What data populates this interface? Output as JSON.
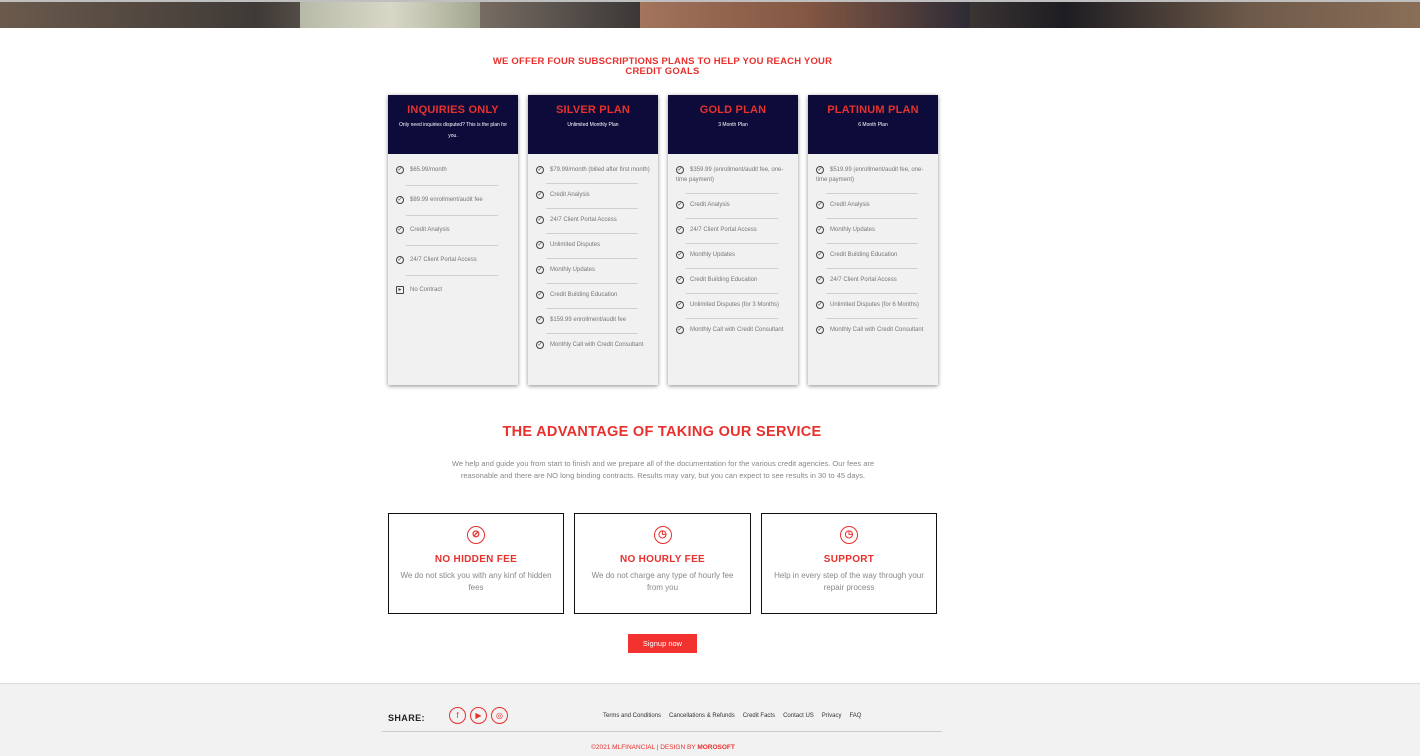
{
  "offer_title": "WE OFFER FOUR SUBSCRIPTIONS PLANS TO HELP YOU REACH YOUR CREDIT GOALS",
  "plans": [
    {
      "name": "INQUIRIES ONLY",
      "subtitle": "Only need inquiries disputed? This is the plan for you.",
      "features": [
        "$65.99/month",
        "$89.99 enrollment/audit fee",
        "Credit Analysis",
        "24/7 Client Portal Access",
        "No Contract"
      ]
    },
    {
      "name": "SILVER PLAN",
      "subtitle": "Unlimited Monthly Plan",
      "features": [
        "$79.99/month (billed after first month)",
        "Credit Analysis",
        "24/7 Client Portal Access",
        "Unlimited Disputes",
        "Monthly Updates",
        "Credit Building Education",
        "$159.99 enrollment/audit fee",
        "Monthly Call with Credit Consultant"
      ]
    },
    {
      "name": "GOLD PLAN",
      "subtitle": "3 Month Plan",
      "features": [
        "$359.99 (enrollment/audit fee, one-time payment)",
        "Credit Analysis",
        "24/7 Client Portal Access",
        "Monthly Updates",
        "Credit Building Education",
        "Unlimited Disputes (for 3 Months)",
        "Monthly Call with Credit Consultant"
      ]
    },
    {
      "name": "PLATINUM PLAN",
      "subtitle": "6 Month Plan",
      "features": [
        "$519.99 (enrollment/audit fee, one-time payment)",
        "Credit Analysis",
        "Monthly Updates",
        "Credit Building Education",
        "24/7 Client Portal Access",
        "Unlimited Disputes (for 6 Months)",
        "Monthly Call with Credit Consultant"
      ]
    }
  ],
  "advantage": {
    "title": "THE ADVANTAGE OF TAKING OUR SERVICE",
    "text": "We help and guide you from start to finish and we prepare all of the documentation for the various credit agencies. Our fees are reasonable and there are NO long binding contracts. Results may vary, but you can expect to see results in 30 to 45 days."
  },
  "boxes": [
    {
      "icon": "no-fee-icon",
      "title": "NO HIDDEN FEE",
      "text": "We do not stick you with any kinf of hidden fees"
    },
    {
      "icon": "clock-icon",
      "title": "NO HOURLY FEE",
      "text": "We do not charge any type of hourly fee from you"
    },
    {
      "icon": "clock-icon",
      "title": "SUPPORT",
      "text": "Help in every step of the way through your repair process"
    }
  ],
  "signup_label": "Signup now",
  "footer": {
    "share_label": "SHARE:",
    "social_icons": [
      "facebook-icon",
      "youtube-icon",
      "instagram-icon"
    ],
    "links": [
      "Terms and Conditions",
      "Cancellations & Refunds",
      "Credit Facts",
      "Contact US",
      "Privacy",
      "FAQ"
    ],
    "copyright": "©2021 MLFINANCIAL  |  DESIGN BY",
    "designer": "MOROSOFT"
  },
  "colors": {
    "accent": "#e8302d",
    "plan_header": "#0d0b3a",
    "button": "#f2322f"
  }
}
